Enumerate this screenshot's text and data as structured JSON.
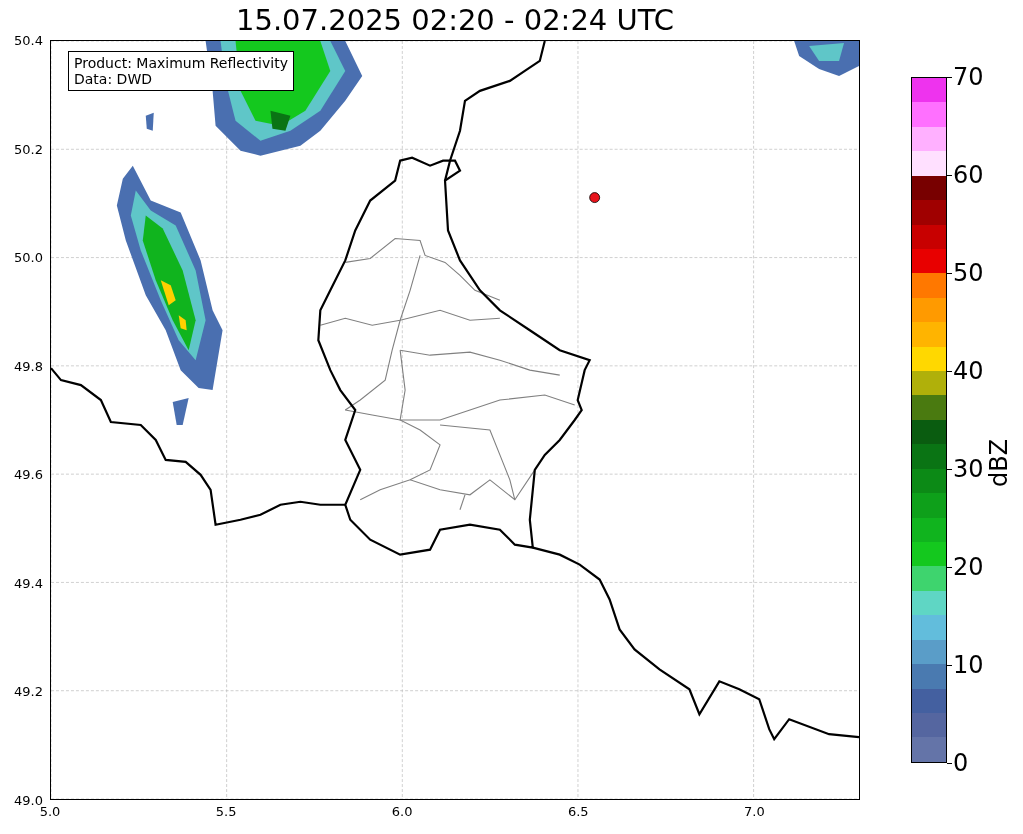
{
  "title": "15.07.2025 02:20 - 02:24 UTC",
  "info_box": {
    "lines": [
      "Product: Maximum Reflectivity",
      "Data: DWD"
    ]
  },
  "y_axis": {
    "ticks": [
      "50.4",
      "50.2",
      "50.0",
      "49.8",
      "49.6",
      "49.4",
      "49.2",
      "49.0"
    ]
  },
  "x_axis": {
    "ticks": [
      "5.0",
      "5.5",
      "6.0",
      "6.5",
      "7.0"
    ]
  },
  "colorbar": {
    "label": "dBZ",
    "ticks": [
      "70",
      "60",
      "50",
      "40",
      "30",
      "20",
      "10",
      "0"
    ],
    "bands": [
      {
        "color": "#ee33ee"
      },
      {
        "color": "#ff70ff"
      },
      {
        "color": "#ffb0ff"
      },
      {
        "color": "#ffe0ff"
      },
      {
        "color": "#780000"
      },
      {
        "color": "#a00000"
      },
      {
        "color": "#c80000"
      },
      {
        "color": "#e80000"
      },
      {
        "color": "#ff7800"
      },
      {
        "color": "#ff9a00"
      },
      {
        "color": "#ffb400"
      },
      {
        "color": "#ffd800"
      },
      {
        "color": "#b0b00a"
      },
      {
        "color": "#4a7a10"
      },
      {
        "color": "#0a5c10"
      },
      {
        "color": "#0a7414"
      },
      {
        "color": "#0c8a16"
      },
      {
        "color": "#0ea01a"
      },
      {
        "color": "#10b41e"
      },
      {
        "color": "#14c81e"
      },
      {
        "color": "#3ed46e"
      },
      {
        "color": "#5fd6c4"
      },
      {
        "color": "#62bddc"
      },
      {
        "color": "#5a9dc8"
      },
      {
        "color": "#4a7ab0"
      },
      {
        "color": "#4460a0"
      },
      {
        "color": "#5566a0"
      },
      {
        "color": "#6474a8"
      }
    ]
  }
}
